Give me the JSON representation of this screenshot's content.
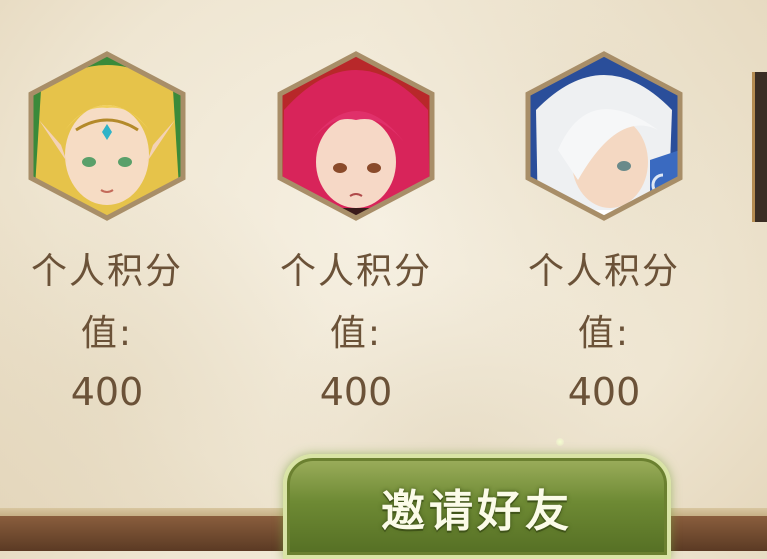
{
  "cards": [
    {
      "line1": "个人积分",
      "line2": "值:",
      "line3": "400",
      "portrait": "elf-heroine-portrait"
    },
    {
      "line1": "个人积分",
      "line2": "值:",
      "line3": "400",
      "portrait": "red-hair-heroine-portrait"
    },
    {
      "line1": "个人积分",
      "line2": "值:",
      "line3": "400",
      "portrait": "white-hair-hero-portrait"
    }
  ],
  "invite_button": {
    "label": "邀请好友"
  },
  "colors": {
    "text": "#6b5238",
    "frame": "#a88e68",
    "button": "#6e8a34"
  }
}
